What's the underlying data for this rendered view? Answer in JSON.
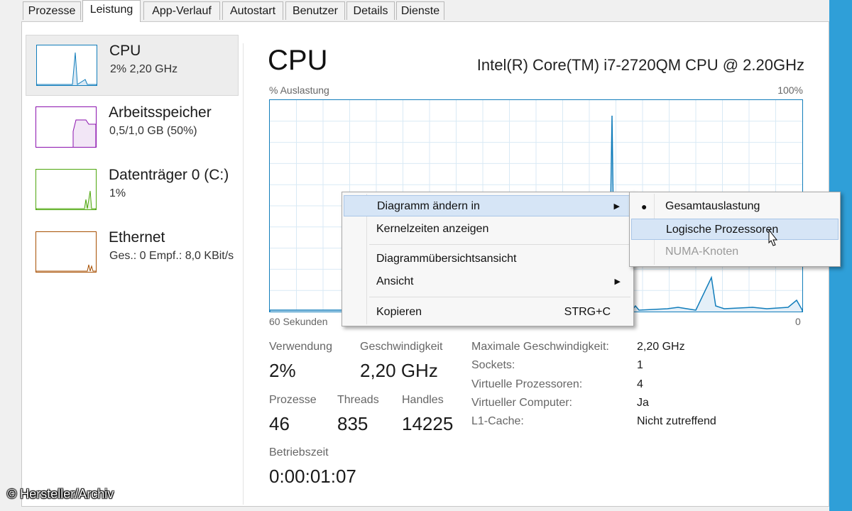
{
  "tabs": [
    "Prozesse",
    "Leistung",
    "App-Verlauf",
    "Autostart",
    "Benutzer",
    "Details",
    "Dienste"
  ],
  "active_tab": "Leistung",
  "sidebar": {
    "items": [
      {
        "name": "CPU",
        "sub": "2% 2,20 GHz",
        "color": "#117dbb"
      },
      {
        "name": "Arbeitsspeicher",
        "sub": "0,5/1,0 GB (50%)",
        "color": "#8b12ae"
      },
      {
        "name": "Datenträger 0 (C:)",
        "sub": "1%",
        "color": "#4da60c"
      },
      {
        "name": "Ethernet",
        "sub": "Ges.: 0 Empf.: 8,0 KBit/s",
        "color": "#a74f01"
      }
    ]
  },
  "main": {
    "title": "CPU",
    "model": "Intel(R) Core(TM) i7-2720QM CPU @ 2.20GHz",
    "graph": {
      "y_label": "% Auslastung",
      "y_max_label": "100%",
      "x_left_label": "60 Sekunden",
      "x_right_label": "0"
    },
    "stats": {
      "usage_label": "Verwendung",
      "usage": "2%",
      "speed_label": "Geschwindigkeit",
      "speed": "2,20 GHz",
      "processes_label": "Prozesse",
      "processes": "46",
      "threads_label": "Threads",
      "threads": "835",
      "handles_label": "Handles",
      "handles": "14225",
      "uptime_label": "Betriebszeit",
      "uptime": "0:00:01:07"
    },
    "info": [
      {
        "key": "Maximale Geschwindigkeit:",
        "value": "2,20 GHz"
      },
      {
        "key": "Sockets:",
        "value": "1"
      },
      {
        "key": "Virtuelle Prozessoren:",
        "value": "4"
      },
      {
        "key": "Virtueller Computer:",
        "value": "Ja"
      },
      {
        "key": "L1-Cache:",
        "value": "Nicht zutreffend"
      }
    ]
  },
  "context_menu": {
    "items": [
      "Diagramm ändern in",
      "Kernelzeiten anzeigen",
      "Diagrammübersichtsansicht",
      "Ansicht",
      "Kopieren"
    ],
    "shortcut_copy": "STRG+C"
  },
  "submenu": {
    "items": [
      "Gesamtauslastung",
      "Logische Prozessoren",
      "NUMA-Knoten"
    ],
    "bullet": "●"
  },
  "watermark": "© Hersteller/Archiv",
  "colors": {
    "cpu": "#117dbb",
    "memory": "#8b12ae",
    "disk": "#4da60c",
    "ethernet": "#a74f01",
    "accent": "#2f9fd8"
  }
}
